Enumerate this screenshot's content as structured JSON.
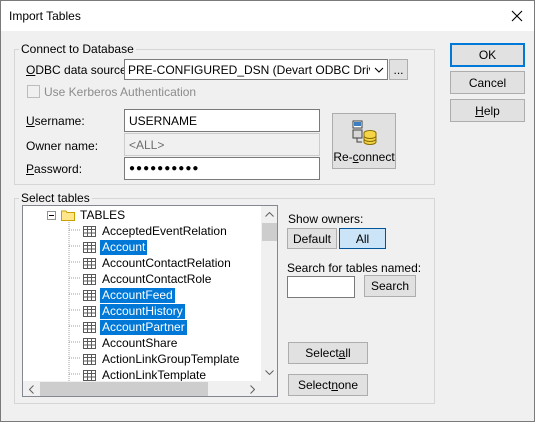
{
  "window": {
    "title": "Import Tables"
  },
  "buttons": {
    "ok": "OK",
    "cancel": "Cancel",
    "help": "Help",
    "help_underline": "H",
    "help_rest": "elp"
  },
  "connect": {
    "group_label": "Connect to Database",
    "odbc_label_underline": "O",
    "odbc_label_rest": "DBC data source:",
    "odbc_value": "PRE-CONFIGURED_DSN (Devart ODBC Driver for Salesforce)",
    "browse_label": "...",
    "kerberos_label": "Use Kerberos Authentication",
    "username_label_underline": "U",
    "username_label_rest": "sername:",
    "username_value": "USERNAME",
    "owner_label": "Owner name:",
    "owner_value": "<ALL>",
    "password_label_underline": "P",
    "password_label_rest": "assword:",
    "password_value": "●●●●●●●●●●",
    "reconnect_pre": "Re-",
    "reconnect_underline": "c",
    "reconnect_rest": "onnect"
  },
  "select": {
    "group_label": "Select tables",
    "tree_root": "TABLES",
    "tables": [
      {
        "name": "AcceptedEventRelation",
        "selected": false
      },
      {
        "name": "Account",
        "selected": true
      },
      {
        "name": "AccountContactRelation",
        "selected": false
      },
      {
        "name": "AccountContactRole",
        "selected": false
      },
      {
        "name": "AccountFeed",
        "selected": true
      },
      {
        "name": "AccountHistory",
        "selected": true
      },
      {
        "name": "AccountPartner",
        "selected": true
      },
      {
        "name": "AccountShare",
        "selected": false
      },
      {
        "name": "ActionLinkGroupTemplate",
        "selected": false
      },
      {
        "name": "ActionLinkTemplate",
        "selected": false
      }
    ],
    "show_owners_label": "Show owners:",
    "default_btn": "Default",
    "all_btn": "All",
    "search_label": "Search for tables named:",
    "search_value": "",
    "search_btn": "Search",
    "select_all_pre": "Select ",
    "select_all_underline": "a",
    "select_all_rest": "ll",
    "select_none_pre": "Select ",
    "select_none_underline": "n",
    "select_none_rest": "one"
  },
  "colors": {
    "selection": "#0078d7",
    "accent": "#0078d7"
  }
}
